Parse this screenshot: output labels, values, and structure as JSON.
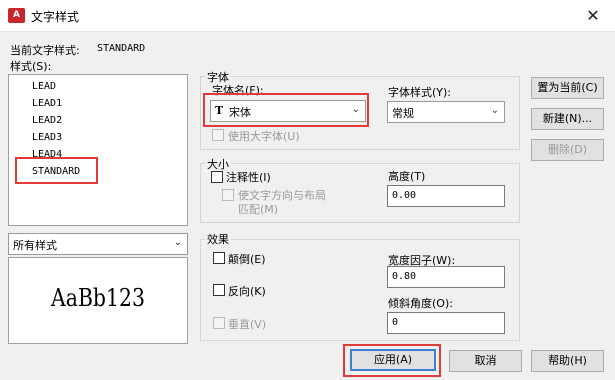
{
  "window": {
    "icon_text": "A",
    "title": "文字样式",
    "close_glyph": "✕"
  },
  "current_style": {
    "label": "当前文字样式:",
    "value": "STANDARD"
  },
  "styles_label": "样式(S):",
  "styles": [
    "LEAD",
    "LEAD1",
    "LEAD2",
    "LEAD3",
    "LEAD4",
    "STANDARD"
  ],
  "filter": {
    "value": "所有样式"
  },
  "preview": {
    "text": "AaBb123"
  },
  "font": {
    "group_label": "字体",
    "name_label": "字体名(F):",
    "name_value": "宋体",
    "tt_glyph": "T",
    "style_label": "字体样式(Y):",
    "style_value": "常规",
    "big_font_label": "使用大字体(U)"
  },
  "size": {
    "group_label": "大小",
    "annotative_label": "注释性(I)",
    "match_layout_label_1": "使文字方向与布局",
    "match_layout_label_2": "匹配(M)",
    "height_label": "高度(T)",
    "height_value": "0.00"
  },
  "effects": {
    "group_label": "效果",
    "upside_down_label": "颠倒(E)",
    "backwards_label": "反向(K)",
    "vertical_label": "垂直(V)",
    "width_factor_label": "宽度因子(W):",
    "width_factor_value": "0.80",
    "oblique_label": "倾斜角度(O):",
    "oblique_value": "0"
  },
  "buttons": {
    "set_current": "置为当前(C)",
    "new": "新建(N)...",
    "delete": "删除(D)",
    "apply": "应用(A)",
    "cancel": "取消",
    "help": "帮助(H)"
  },
  "colors": {
    "highlight": "#e23a3a",
    "default_button_border": "#3c7fd4"
  }
}
